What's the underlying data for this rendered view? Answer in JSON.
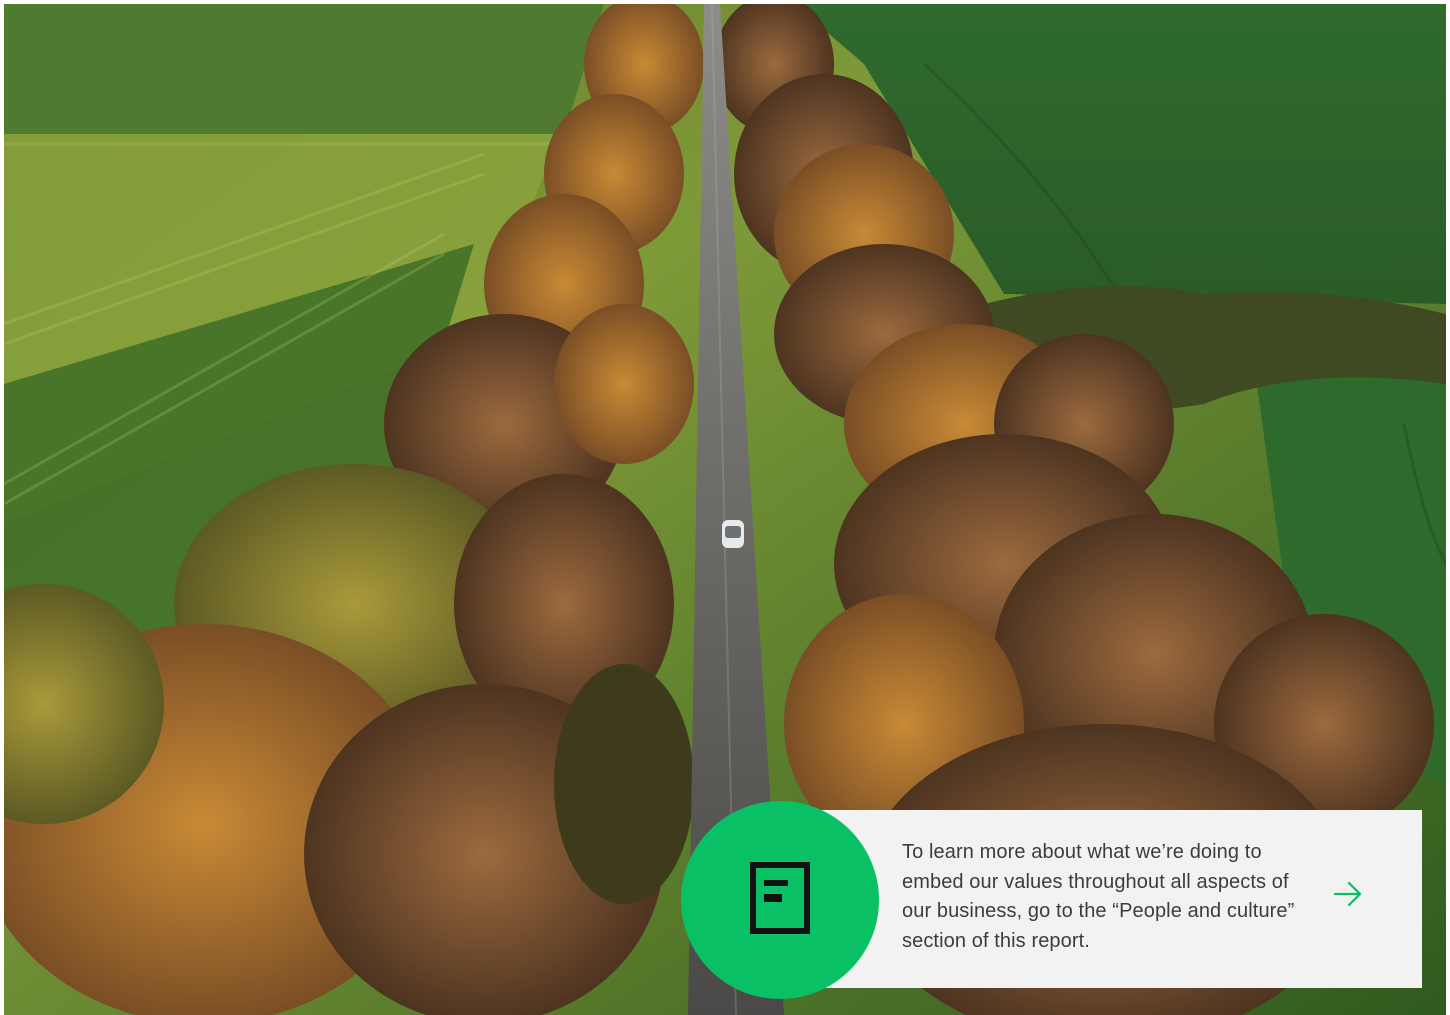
{
  "callout": {
    "text": "To learn more about what we’re doing to embed our values throughout all aspects of our business, go to the “People and culture” section of this report."
  },
  "icons": {
    "badge": "document-icon",
    "link": "arrow-right-icon"
  },
  "colors": {
    "accent_green": "#0ac065",
    "card_background": "#f2f2f3",
    "text": "#3c3c3c"
  }
}
